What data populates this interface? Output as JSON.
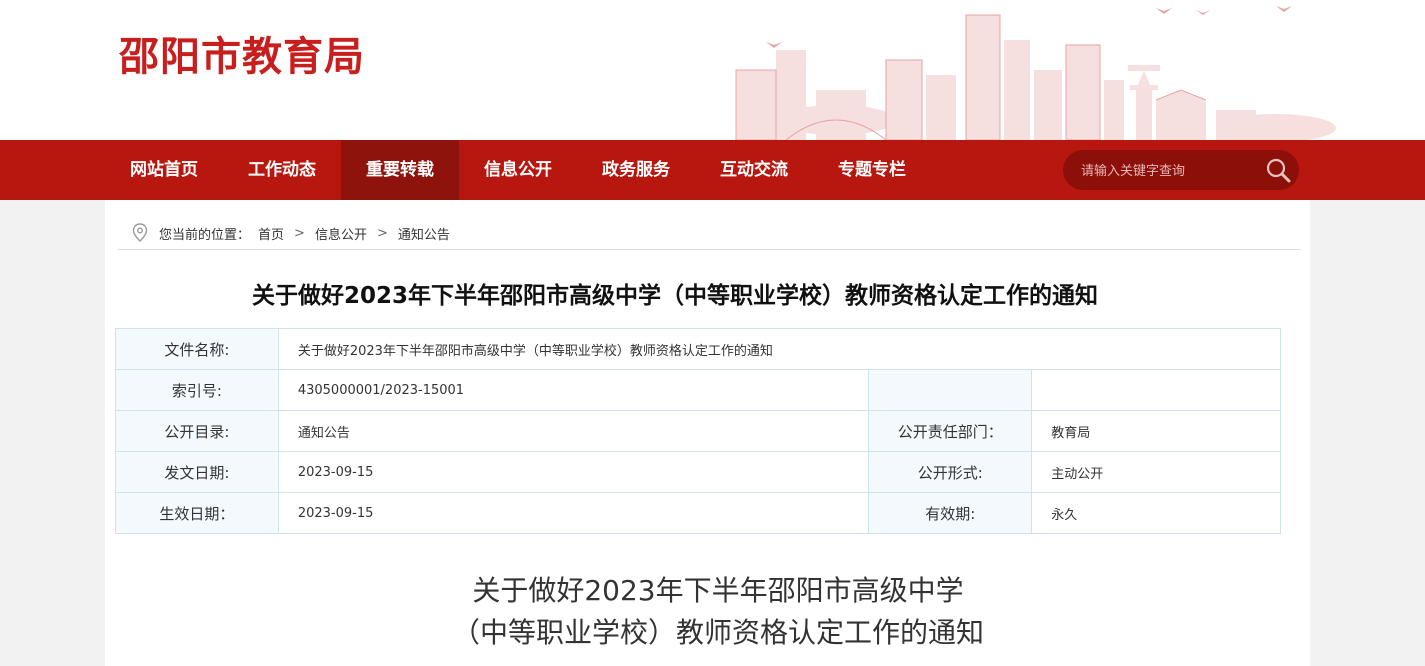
{
  "header": {
    "site_title": "邵阳市教育局"
  },
  "nav": {
    "items": [
      "网站首页",
      "工作动态",
      "重要转载",
      "信息公开",
      "政务服务",
      "互动交流",
      "专题专栏"
    ],
    "active_index": 2
  },
  "search": {
    "placeholder": "请输入关键字查询"
  },
  "breadcrumb": {
    "prefix": "您当前的位置：",
    "items": [
      "首页",
      "信息公开",
      "通知公告"
    ],
    "separator": ">"
  },
  "article": {
    "title": "关于做好2023年下半年邵阳市高级中学（中等职业学校）教师资格认定工作的通知",
    "heading_line1": "关于做好2023年下半年邵阳市高级中学",
    "heading_line2": "（中等职业学校）教师资格认定工作的通知"
  },
  "meta": {
    "doc_name_label": "文件名称:",
    "doc_name_value": "关于做好2023年下半年邵阳市高级中学（中等职业学校）教师资格认定工作的通知",
    "index_label": "索引号:",
    "index_value": "4305000001/2023-15001",
    "catalog_label": "公开目录:",
    "catalog_value": "通知公告",
    "dept_label": "公开责任部门：",
    "dept_value": "教育局",
    "issue_date_label": "发文日期:",
    "issue_date_value": "2023-09-15",
    "form_label": "公开形式:",
    "form_value": "主动公开",
    "effective_date_label": "生效日期：",
    "effective_date_value": "2023-09-15",
    "validity_label": "有效期:",
    "validity_value": "永久"
  },
  "colors": {
    "brand_red": "#b8170f",
    "active_red": "#8e130c",
    "title_red": "#c81e1e",
    "table_border": "#cfe3ef"
  }
}
